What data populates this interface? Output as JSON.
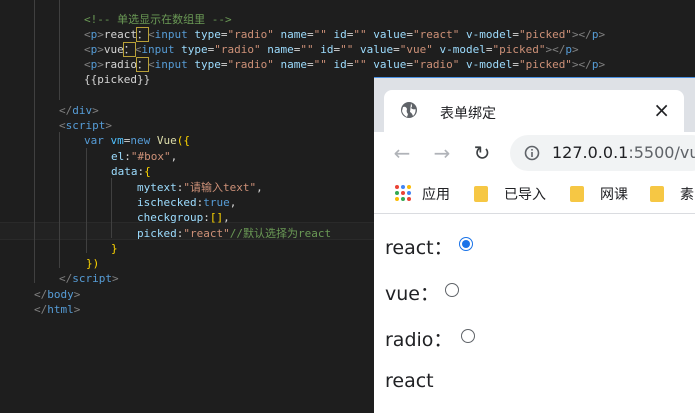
{
  "editor": {
    "lines": [
      {
        "spans": [
          {
            "c": "c-com",
            "t": "<!-- 单选显示在数组里 -->"
          }
        ]
      },
      {
        "spans": [
          {
            "c": "c-br",
            "t": "<"
          },
          {
            "c": "c-tag",
            "t": "p"
          },
          {
            "c": "c-br",
            "t": ">"
          },
          {
            "c": "c-txt",
            "t": "react"
          },
          {
            "c": "c-txt hl",
            "t": "："
          },
          {
            "c": "c-br",
            "t": "<"
          },
          {
            "c": "c-tag",
            "t": "input"
          },
          {
            "c": "c-txt",
            "t": " "
          },
          {
            "c": "c-attr",
            "t": "type"
          },
          {
            "c": "c-txt",
            "t": "="
          },
          {
            "c": "c-str",
            "t": "\"radio\""
          },
          {
            "c": "c-txt",
            "t": " "
          },
          {
            "c": "c-attr",
            "t": "name"
          },
          {
            "c": "c-txt",
            "t": "="
          },
          {
            "c": "c-str",
            "t": "\"\""
          },
          {
            "c": "c-txt",
            "t": " "
          },
          {
            "c": "c-attr",
            "t": "id"
          },
          {
            "c": "c-txt",
            "t": "="
          },
          {
            "c": "c-str",
            "t": "\"\""
          },
          {
            "c": "c-txt",
            "t": " "
          },
          {
            "c": "c-attr",
            "t": "value"
          },
          {
            "c": "c-txt",
            "t": "="
          },
          {
            "c": "c-str",
            "t": "\"react\""
          },
          {
            "c": "c-txt",
            "t": " "
          },
          {
            "c": "c-attr",
            "t": "v-model"
          },
          {
            "c": "c-txt",
            "t": "="
          },
          {
            "c": "c-str",
            "t": "\"picked\""
          },
          {
            "c": "c-br",
            "t": "></"
          },
          {
            "c": "c-tag",
            "t": "p"
          },
          {
            "c": "c-br",
            "t": ">"
          }
        ]
      },
      {
        "spans": [
          {
            "c": "c-br",
            "t": "<"
          },
          {
            "c": "c-tag",
            "t": "p"
          },
          {
            "c": "c-br",
            "t": ">"
          },
          {
            "c": "c-txt",
            "t": "vue"
          },
          {
            "c": "c-txt hl",
            "t": "："
          },
          {
            "c": "c-br",
            "t": "<"
          },
          {
            "c": "c-tag",
            "t": "input"
          },
          {
            "c": "c-txt",
            "t": " "
          },
          {
            "c": "c-attr",
            "t": "type"
          },
          {
            "c": "c-txt",
            "t": "="
          },
          {
            "c": "c-str",
            "t": "\"radio\""
          },
          {
            "c": "c-txt",
            "t": " "
          },
          {
            "c": "c-attr",
            "t": "name"
          },
          {
            "c": "c-txt",
            "t": "="
          },
          {
            "c": "c-str",
            "t": "\"\""
          },
          {
            "c": "c-txt",
            "t": " "
          },
          {
            "c": "c-attr",
            "t": "id"
          },
          {
            "c": "c-txt",
            "t": "="
          },
          {
            "c": "c-str",
            "t": "\"\""
          },
          {
            "c": "c-txt",
            "t": " "
          },
          {
            "c": "c-attr",
            "t": "value"
          },
          {
            "c": "c-txt",
            "t": "="
          },
          {
            "c": "c-str",
            "t": "\"vue\""
          },
          {
            "c": "c-txt",
            "t": " "
          },
          {
            "c": "c-attr",
            "t": "v-model"
          },
          {
            "c": "c-txt",
            "t": "="
          },
          {
            "c": "c-str",
            "t": "\"picked\""
          },
          {
            "c": "c-br",
            "t": "></"
          },
          {
            "c": "c-tag",
            "t": "p"
          },
          {
            "c": "c-br",
            "t": ">"
          }
        ]
      },
      {
        "spans": [
          {
            "c": "c-br",
            "t": "<"
          },
          {
            "c": "c-tag",
            "t": "p"
          },
          {
            "c": "c-br",
            "t": ">"
          },
          {
            "c": "c-txt",
            "t": "radio"
          },
          {
            "c": "c-txt hl",
            "t": "："
          },
          {
            "c": "c-br",
            "t": "<"
          },
          {
            "c": "c-tag",
            "t": "input"
          },
          {
            "c": "c-txt",
            "t": " "
          },
          {
            "c": "c-attr",
            "t": "type"
          },
          {
            "c": "c-txt",
            "t": "="
          },
          {
            "c": "c-str",
            "t": "\"radio\""
          },
          {
            "c": "c-txt",
            "t": " "
          },
          {
            "c": "c-attr",
            "t": "name"
          },
          {
            "c": "c-txt",
            "t": "="
          },
          {
            "c": "c-str",
            "t": "\"\""
          },
          {
            "c": "c-txt",
            "t": " "
          },
          {
            "c": "c-attr",
            "t": "id"
          },
          {
            "c": "c-txt",
            "t": "="
          },
          {
            "c": "c-str",
            "t": "\"\""
          },
          {
            "c": "c-txt",
            "t": " "
          },
          {
            "c": "c-attr",
            "t": "value"
          },
          {
            "c": "c-txt",
            "t": "="
          },
          {
            "c": "c-str",
            "t": "\"radio\""
          },
          {
            "c": "c-txt",
            "t": " "
          },
          {
            "c": "c-attr",
            "t": "v-model"
          },
          {
            "c": "c-txt",
            "t": "="
          },
          {
            "c": "c-str",
            "t": "\"picked\""
          },
          {
            "c": "c-br",
            "t": "></"
          },
          {
            "c": "c-tag",
            "t": "p"
          },
          {
            "c": "c-br",
            "t": ">"
          }
        ]
      },
      {
        "spans": [
          {
            "c": "c-txt",
            "t": "{{picked}}"
          }
        ]
      },
      {
        "spans": []
      },
      {
        "spans": [
          {
            "c": "c-br",
            "t": "</"
          },
          {
            "c": "c-tag",
            "t": "div"
          },
          {
            "c": "c-br",
            "t": ">"
          }
        ]
      },
      {
        "spans": [
          {
            "c": "c-br",
            "t": "<"
          },
          {
            "c": "c-tag",
            "t": "script"
          },
          {
            "c": "c-br",
            "t": ">"
          }
        ]
      },
      {
        "spans": [
          {
            "c": "c-key",
            "t": "var"
          },
          {
            "c": "c-txt",
            "t": " "
          },
          {
            "c": "c-blue",
            "t": "vm"
          },
          {
            "c": "c-txt",
            "t": "="
          },
          {
            "c": "c-key",
            "t": "new"
          },
          {
            "c": "c-txt",
            "t": " "
          },
          {
            "c": "c-fn",
            "t": "Vue"
          },
          {
            "c": "c-pun",
            "t": "({"
          }
        ]
      },
      {
        "spans": [
          {
            "c": "c-attr",
            "t": "el"
          },
          {
            "c": "c-txt",
            "t": ":"
          },
          {
            "c": "c-str",
            "t": "\"#box\""
          },
          {
            "c": "c-txt",
            "t": ","
          }
        ]
      },
      {
        "spans": [
          {
            "c": "c-attr",
            "t": "data"
          },
          {
            "c": "c-txt",
            "t": ":"
          },
          {
            "c": "c-pun",
            "t": "{"
          }
        ]
      },
      {
        "spans": [
          {
            "c": "c-attr",
            "t": "mytext"
          },
          {
            "c": "c-txt",
            "t": ":"
          },
          {
            "c": "c-str",
            "t": "\"请输入text\""
          },
          {
            "c": "c-txt",
            "t": ","
          }
        ]
      },
      {
        "spans": [
          {
            "c": "c-attr",
            "t": "ischecked"
          },
          {
            "c": "c-txt",
            "t": ":"
          },
          {
            "c": "c-key",
            "t": "true"
          },
          {
            "c": "c-txt",
            "t": ","
          }
        ]
      },
      {
        "spans": [
          {
            "c": "c-attr",
            "t": "checkgroup"
          },
          {
            "c": "c-txt",
            "t": ":"
          },
          {
            "c": "c-pun",
            "t": "[]"
          },
          {
            "c": "c-txt",
            "t": ","
          }
        ]
      },
      {
        "spans": [
          {
            "c": "c-attr",
            "t": "picked"
          },
          {
            "c": "c-txt",
            "t": ":"
          },
          {
            "c": "c-str",
            "t": "\"react\""
          },
          {
            "c": "c-com",
            "t": "//默认选择为react"
          }
        ]
      },
      {
        "spans": [
          {
            "c": "c-pun",
            "t": "}"
          }
        ]
      },
      {
        "spans": [
          {
            "c": "c-pun",
            "t": "})"
          }
        ]
      },
      {
        "spans": [
          {
            "c": "c-br",
            "t": "</"
          },
          {
            "c": "c-tag",
            "t": "script"
          },
          {
            "c": "c-br",
            "t": ">"
          }
        ]
      },
      {
        "spans": [
          {
            "c": "c-br",
            "t": "</"
          },
          {
            "c": "c-tag",
            "t": "body"
          },
          {
            "c": "c-br",
            "t": ">"
          }
        ]
      },
      {
        "spans": [
          {
            "c": "c-br",
            "t": "</"
          },
          {
            "c": "c-tag",
            "t": "html"
          },
          {
            "c": "c-br",
            "t": ">"
          }
        ]
      }
    ]
  },
  "browser": {
    "tab_title": "表单绑定",
    "tab_close": "×",
    "back_icon": "←",
    "forward_icon": "→",
    "reload_icon": "↻",
    "url_host": "127.0.0.1",
    "url_rest": ":5500/vu",
    "bookmarks": {
      "apps_label": "应用",
      "items": [
        "已导入",
        "网课",
        "素"
      ]
    },
    "form": {
      "react_label": "react：",
      "vue_label": "vue：",
      "radio_label": "radio：",
      "picked_value": "react"
    }
  }
}
